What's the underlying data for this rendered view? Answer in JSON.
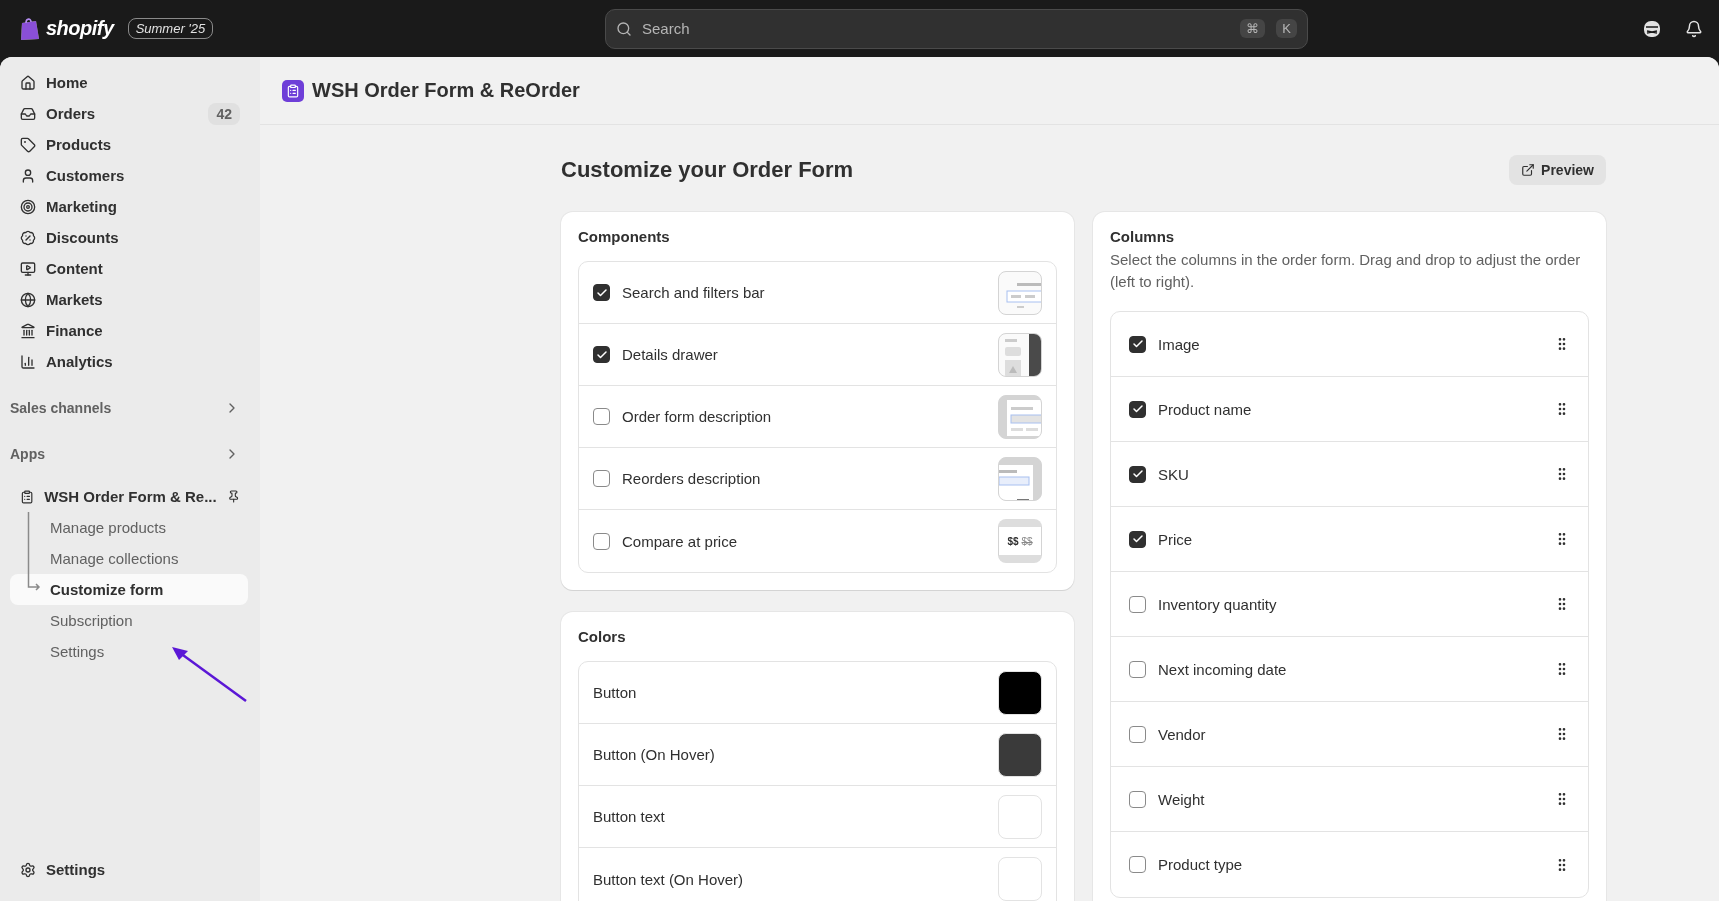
{
  "topbar": {
    "brand": "shopify",
    "edition": "Summer '25",
    "search": {
      "placeholder": "Search"
    },
    "shortcut": [
      "⌘",
      "K"
    ]
  },
  "sidebar": {
    "items": [
      {
        "label": "Home",
        "selected": false
      },
      {
        "label": "Orders",
        "badge": "42",
        "selected": false
      },
      {
        "label": "Products",
        "selected": false
      },
      {
        "label": "Customers",
        "selected": false
      },
      {
        "label": "Marketing",
        "selected": false
      },
      {
        "label": "Discounts",
        "selected": false
      },
      {
        "label": "Content",
        "selected": false
      },
      {
        "label": "Markets",
        "selected": false
      },
      {
        "label": "Finance",
        "selected": false
      },
      {
        "label": "Analytics",
        "selected": false
      }
    ],
    "sections": [
      {
        "label": "Sales channels"
      },
      {
        "label": "Apps"
      }
    ],
    "app": {
      "label": "WSH Order Form & Re...",
      "children": [
        {
          "label": "Manage products",
          "selected": false
        },
        {
          "label": "Manage collections",
          "selected": false
        },
        {
          "label": "Customize form",
          "selected": true
        },
        {
          "label": "Subscription",
          "selected": false
        },
        {
          "label": "Settings",
          "selected": false
        }
      ]
    },
    "footer": {
      "label": "Settings"
    }
  },
  "page": {
    "app_title": "WSH Order Form & ReOrder",
    "heading": "Customize your Order Form",
    "preview_button": "Preview"
  },
  "components": {
    "title": "Components",
    "items": [
      {
        "label": "Search and filters bar",
        "checked": true
      },
      {
        "label": "Details drawer",
        "checked": true
      },
      {
        "label": "Order form description",
        "checked": false
      },
      {
        "label": "Reorders description",
        "checked": false
      },
      {
        "label": "Compare at price",
        "checked": false,
        "price": "$$",
        "compare": "$$"
      }
    ]
  },
  "colors": {
    "title": "Colors",
    "items": [
      {
        "label": "Button",
        "color": "#000000"
      },
      {
        "label": "Button (On Hover)",
        "color": "#3a3a3a"
      },
      {
        "label": "Button text",
        "color": "#ffffff"
      },
      {
        "label": "Button text (On Hover)",
        "color": "#ffffff"
      }
    ]
  },
  "columns": {
    "title": "Columns",
    "description": "Select the columns in the order form. Drag and drop to adjust the order (left to right).",
    "items": [
      {
        "label": "Image",
        "checked": true
      },
      {
        "label": "Product name",
        "checked": true
      },
      {
        "label": "SKU",
        "checked": true
      },
      {
        "label": "Price",
        "checked": true
      },
      {
        "label": "Inventory quantity",
        "checked": false
      },
      {
        "label": "Next incoming date",
        "checked": false
      },
      {
        "label": "Vendor",
        "checked": false
      },
      {
        "label": "Weight",
        "checked": false
      },
      {
        "label": "Product type",
        "checked": false
      }
    ]
  }
}
